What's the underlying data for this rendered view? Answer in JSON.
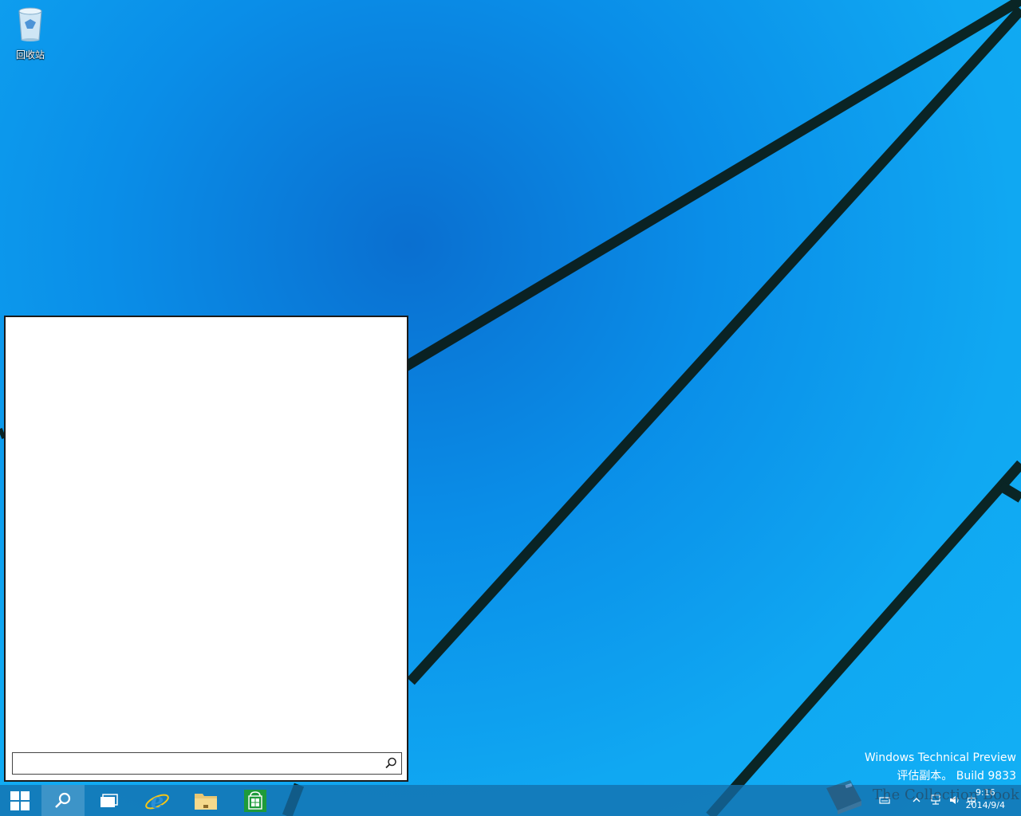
{
  "desktop": {
    "recycle_bin_label": "回收站"
  },
  "search_panel": {
    "input_value": "",
    "input_placeholder": ""
  },
  "watermark": {
    "line1": "Windows Technical Preview",
    "line2": "评估副本。 Build 9833"
  },
  "taskbar": {
    "apps": [
      "start-icon",
      "search-icon",
      "task-view-icon",
      "internet-explorer-icon",
      "file-explorer-icon",
      "store-icon"
    ],
    "clock_time": "9:16",
    "clock_date": "2014/9/4",
    "ime_label": "中"
  },
  "overlay": {
    "collection_text": "The Collection Book"
  },
  "colors": {
    "accent": "#0a8ee8",
    "taskbar": "#1a6ea8",
    "store_green": "#1e9b3a",
    "ie_blue": "#2a8fd8"
  }
}
